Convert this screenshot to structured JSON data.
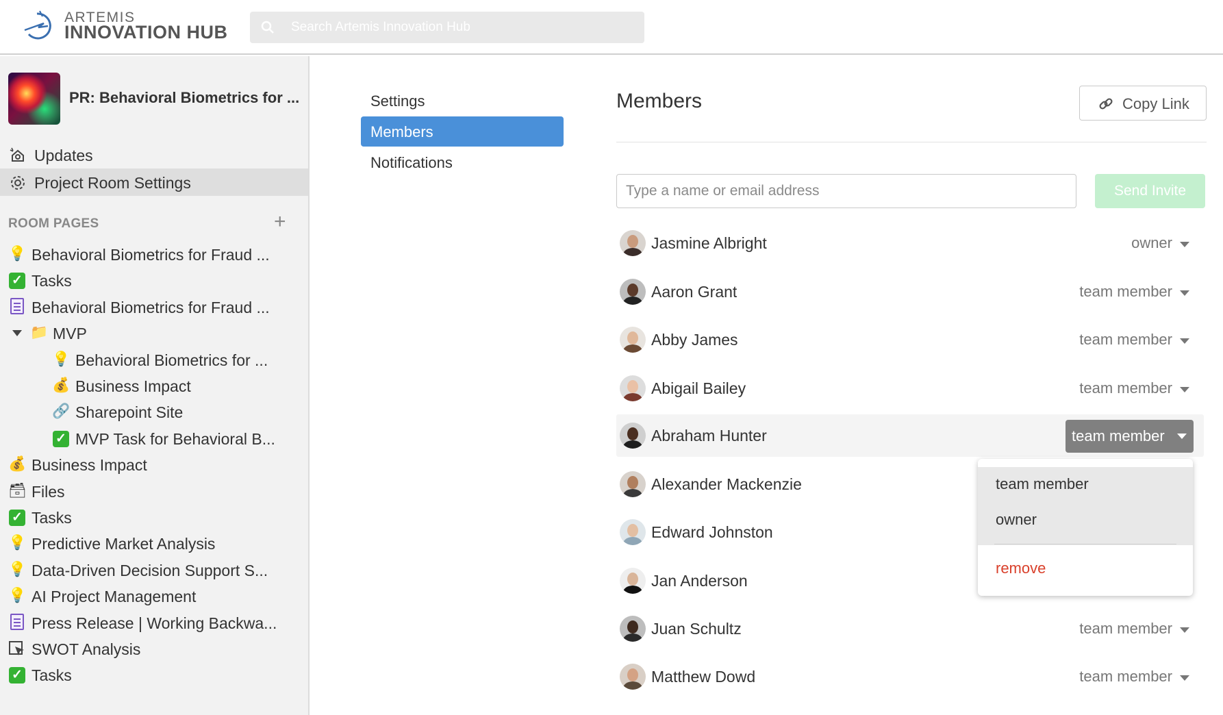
{
  "header": {
    "logo_line1": "ARTEMIS",
    "logo_line2": "INNOVATION HUB",
    "search_placeholder": "Search Artemis Innovation Hub"
  },
  "sidebar": {
    "room_title": "PR: Behavioral Biometrics for ...",
    "nav": [
      {
        "label": "Updates",
        "icon": "updates-icon"
      },
      {
        "label": "Project Room Settings",
        "icon": "gear-icon",
        "active": true
      }
    ],
    "section_label": "ROOM PAGES",
    "add_icon": "plus-icon",
    "pages": [
      {
        "label": "Behavioral Biometrics for Fraud ...",
        "icon": "lightbulb-icon"
      },
      {
        "label": "Tasks",
        "icon": "checkbox-icon"
      },
      {
        "label": "Behavioral Biometrics for Fraud ...",
        "icon": "document-icon"
      },
      {
        "label": "MVP",
        "icon": "folder-icon",
        "expanded": true
      },
      {
        "label": "Behavioral Biometrics for ...",
        "icon": "lightbulb-icon"
      },
      {
        "label": "Business Impact",
        "icon": "money-bag-icon"
      },
      {
        "label": "Sharepoint Site",
        "icon": "link-icon"
      },
      {
        "label": "MVP Task for Behavioral B...",
        "icon": "checkbox-icon"
      },
      {
        "label": "Business Impact",
        "icon": "money-bag-icon"
      },
      {
        "label": "Files",
        "icon": "file-box-icon"
      },
      {
        "label": "Tasks",
        "icon": "checkbox-icon"
      },
      {
        "label": "Predictive Market Analysis",
        "icon": "lightbulb-icon"
      },
      {
        "label": "Data-Driven Decision Support S...",
        "icon": "lightbulb-icon"
      },
      {
        "label": "AI Project Management",
        "icon": "lightbulb-icon"
      },
      {
        "label": "Press Release | Working Backwa...",
        "icon": "document-icon"
      },
      {
        "label": "SWOT Analysis",
        "icon": "cursor-board-icon"
      },
      {
        "label": "Tasks",
        "icon": "checkbox-icon"
      }
    ]
  },
  "settings_nav": {
    "items": [
      "Settings",
      "Members",
      "Notifications"
    ],
    "active": "Members"
  },
  "members_panel": {
    "title": "Members",
    "copy_link_label": "Copy Link",
    "invite_placeholder": "Type a name or email address",
    "send_invite_label": "Send Invite",
    "members": [
      {
        "name": "Jasmine Albright",
        "role": "owner"
      },
      {
        "name": "Aaron Grant",
        "role": "team member"
      },
      {
        "name": "Abby James",
        "role": "team member"
      },
      {
        "name": "Abigail Bailey",
        "role": "team member"
      },
      {
        "name": "Abraham Hunter",
        "role": "team member"
      },
      {
        "name": "Alexander Mackenzie",
        "role": ""
      },
      {
        "name": "Edward Johnston",
        "role": ""
      },
      {
        "name": "Jan Anderson",
        "role": ""
      },
      {
        "name": "Juan Schultz",
        "role": "team member"
      },
      {
        "name": "Matthew Dowd",
        "role": "team member"
      }
    ],
    "role_dropdown": {
      "options": [
        "team member",
        "owner"
      ],
      "remove_label": "remove"
    }
  },
  "colors": {
    "accent": "#4a90d9",
    "send_invite_bg": "#c4f0cf",
    "remove": "#d9402b",
    "active_role_button": "#808080"
  }
}
